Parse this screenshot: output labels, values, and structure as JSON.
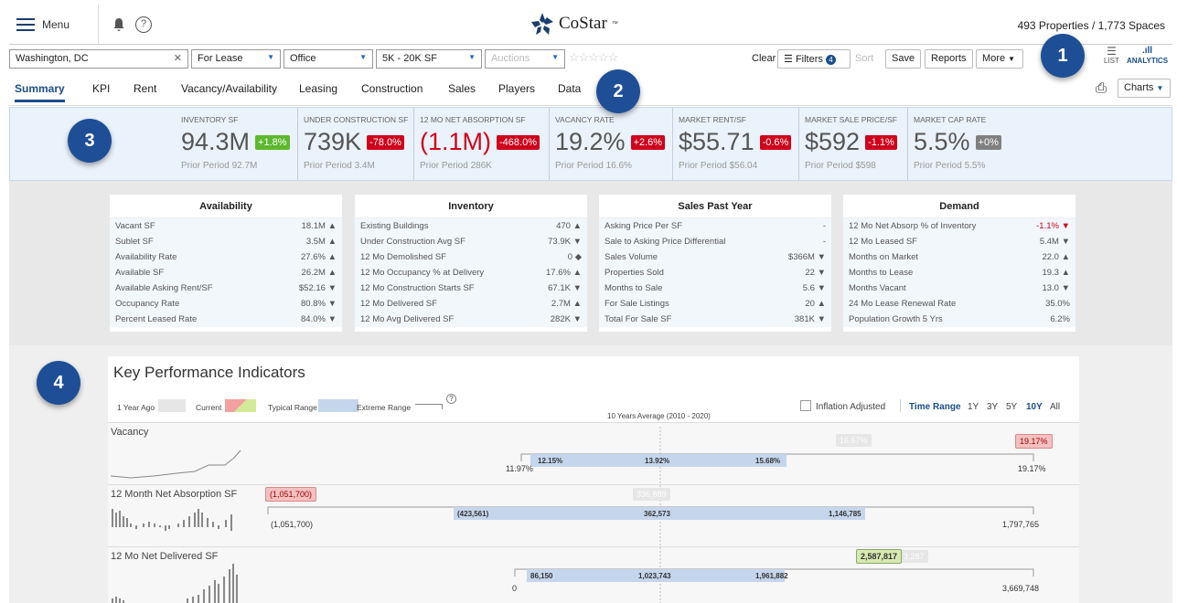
{
  "header": {
    "menu_label": "Menu",
    "logo_text": "CoStar",
    "logo_tm": "™",
    "properties_text": "493 Properties / 1,773 Spaces"
  },
  "toolbar": {
    "location": "Washington, DC",
    "listing_type": "For Lease",
    "property_type": "Office",
    "size_range": "5K - 20K SF",
    "auctions_placeholder": "Auctions",
    "clear_label": "Clear",
    "filters_label": "Filters",
    "filters_count": "4",
    "sort_label": "Sort",
    "save_label": "Save",
    "reports_label": "Reports",
    "more_label": "More",
    "list_label": "LIST",
    "analytics_label": "ANALYTICS",
    "charts_label": "Charts"
  },
  "tabs": [
    "Summary",
    "KPI",
    "Rent",
    "Vacancy/Availability",
    "Leasing",
    "Construction",
    "Sales",
    "Players",
    "Data"
  ],
  "badges": [
    "1",
    "2",
    "3",
    "4"
  ],
  "stats": [
    {
      "label": "INVENTORY SF",
      "value": "94.3M",
      "change": "+1.8%",
      "change_color": "#5cb82e",
      "prior": "Prior Period 92.7M",
      "value_red": false
    },
    {
      "label": "UNDER CONSTRUCTION SF",
      "value": "739K",
      "change": "-78.0%",
      "change_color": "#d0021b",
      "prior": "Prior Period 3.4M",
      "value_red": false
    },
    {
      "label": "12 MO NET ABSORPTION SF",
      "value": "(1.1M)",
      "change": "-468.0%",
      "change_color": "#d0021b",
      "prior": "Prior Period 286K",
      "value_red": true
    },
    {
      "label": "VACANCY RATE",
      "value": "19.2%",
      "change": "+2.6%",
      "change_color": "#d0021b",
      "prior": "Prior Period 16.6%",
      "value_red": false
    },
    {
      "label": "MARKET RENT/SF",
      "value": "$55.71",
      "change": "-0.6%",
      "change_color": "#d0021b",
      "prior": "Prior Period $56.04",
      "value_red": false
    },
    {
      "label": "MARKET SALE PRICE/SF",
      "value": "$592",
      "change": "-1.1%",
      "change_color": "#d0021b",
      "prior": "Prior Period $598",
      "value_red": false
    },
    {
      "label": "MARKET CAP RATE",
      "value": "5.5%",
      "change": "+0%",
      "change_color": "#808080",
      "prior": "Prior Period 5.5%",
      "value_red": false
    }
  ],
  "cards": [
    {
      "title": "Availability",
      "rows": [
        [
          "Vacant SF",
          "18.1M ▲"
        ],
        [
          "Sublet SF",
          "3.5M ▲"
        ],
        [
          "Availability Rate",
          "27.6% ▲"
        ],
        [
          "Available SF",
          "26.2M ▲"
        ],
        [
          "Available Asking Rent/SF",
          "$52.16 ▼"
        ],
        [
          "Occupancy Rate",
          "80.8% ▼"
        ],
        [
          "Percent Leased Rate",
          "84.0% ▼"
        ]
      ]
    },
    {
      "title": "Inventory",
      "rows": [
        [
          "Existing Buildings",
          "470 ▲"
        ],
        [
          "Under Construction Avg SF",
          "73.9K ▼"
        ],
        [
          "12 Mo Demolished SF",
          "0 ◆"
        ],
        [
          "12 Mo Occupancy % at Delivery",
          "17.6% ▲"
        ],
        [
          "12 Mo Construction Starts SF",
          "67.1K ▼"
        ],
        [
          "12 Mo Delivered SF",
          "2.7M ▲"
        ],
        [
          "12 Mo Avg Delivered SF",
          "282K ▼"
        ]
      ]
    },
    {
      "title": "Sales Past Year",
      "rows": [
        [
          "Asking Price Per SF",
          "-"
        ],
        [
          "Sale to Asking Price Differential",
          "-"
        ],
        [
          "Sales Volume",
          "$366M ▼"
        ],
        [
          "Properties Sold",
          "22 ▼"
        ],
        [
          "Months to Sale",
          "5.6 ▼"
        ],
        [
          "For Sale Listings",
          "20 ▲"
        ],
        [
          "Total For Sale SF",
          "381K ▼"
        ]
      ]
    },
    {
      "title": "Demand",
      "rows": [
        [
          "12 Mo Net Absorp % of Inventory",
          "-1.1% ▼"
        ],
        [
          "12 Mo Leased SF",
          "5.4M ▼"
        ],
        [
          "Months on Market",
          "22.0 ▲"
        ],
        [
          "Months to Lease",
          "19.3 ▲"
        ],
        [
          "Months Vacant",
          "13.0 ▼"
        ],
        [
          "24 Mo Lease Renewal Rate",
          "35.0%"
        ],
        [
          "Population Growth 5 Yrs",
          "6.2%"
        ]
      ]
    }
  ],
  "kpi": {
    "title": "Key Performance Indicators",
    "legend": {
      "year_ago": "1 Year Ago",
      "current": "Current",
      "typical": "Typical Range",
      "extreme": "Extreme Range",
      "help": "?"
    },
    "inflation_label": "Inflation Adjusted",
    "time_range_label": "Time Range",
    "ranges": [
      "1Y",
      "3Y",
      "5Y",
      "10Y",
      "All"
    ],
    "active_range": "10Y",
    "avg_label": "10 Years Average (2010 - 2020)",
    "rows": [
      {
        "name": "Vacancy",
        "min": "11.97%",
        "max": "19.17%",
        "typ_low": "12.15%",
        "mid": "13.92%",
        "typ_high": "15.68%",
        "year_ago": "16.67%",
        "current": "19.17%",
        "current_color": "#f3c1c1"
      },
      {
        "name": "12 Month Net Absorption SF",
        "min": "(1,051,700)",
        "max": "1,797,765",
        "typ_low": "(423,561)",
        "mid": "362,573",
        "typ_high": "1,146,785",
        "year_ago": "336,889",
        "current": "(1,051,700)",
        "current_color": "#f3c1c1"
      },
      {
        "name": "12 Mo Net Delivered SF",
        "min": "0",
        "max": "3,669,748",
        "typ_low": "86,150",
        "mid": "1,023,743",
        "typ_high": "1,961,882",
        "year_ago": "3,287",
        "current": "2,587,817",
        "current_color": "#d7e8b0"
      }
    ]
  },
  "colors": {
    "accent": "#1a4e8c",
    "badge": "#1e4f96",
    "typical_range": "#aec4e0",
    "stats_bg": "#eaf2fb"
  }
}
